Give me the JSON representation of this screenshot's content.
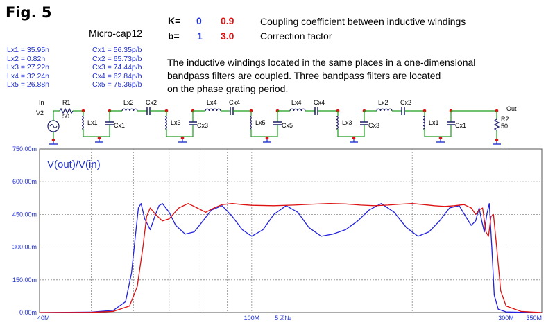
{
  "figure": {
    "label": "Fig. 5",
    "software": "Micro-cap12",
    "description_lines": [
      "The inductive windings located in the same places in a one-dimensional",
      "bandpass filters are coupled.  Three bandpass filters are located",
      "on the phase grating period."
    ]
  },
  "parameters": {
    "k_label": "K=",
    "k_values": [
      "0",
      "0.9"
    ],
    "k_desc": "Coupling coefficient between inductive windings",
    "b_label": "b=",
    "b_values": [
      "1",
      "3.0"
    ],
    "b_desc": "Correction factor",
    "colors": {
      "first": "#2233cc",
      "second": "#dd1111"
    }
  },
  "component_values": {
    "inductors": [
      "Lx1 = 35.95n",
      "Lx2 =   0.82n",
      "Lx3 = 27.22n",
      "Lx4 = 32.24n",
      "Lx5 = 26.88n"
    ],
    "capacitors": [
      "Cx1 = 56.35p/b",
      "Cx2 = 65.73p/b",
      "Cx3 = 74.44p/b",
      "Cx4 = 62.84p/b",
      "Cx5 = 75.36p/b"
    ]
  },
  "schematic": {
    "labels": {
      "in": "In",
      "v2": "V2",
      "r1": "R1",
      "r1_val": "50",
      "out": "Out",
      "r2": "R2",
      "r2_val": "50",
      "series": [
        "Lx2",
        "Cx2",
        "Lx4",
        "Cx4",
        "Lx4",
        "Cx4",
        "Lx2",
        "Cx2"
      ],
      "shunt_l": [
        "Lx1",
        "Lx3",
        "Lx5",
        "Lx3",
        "Lx1"
      ],
      "shunt_c": [
        "Cx1",
        "Cx3",
        "Cx5",
        "Cx3",
        "Cx1"
      ]
    },
    "colors": {
      "wire": "#1a9c1a",
      "component": "#1a1a66",
      "node": "#dd1111",
      "ground": "#2233cc"
    }
  },
  "chart_data": {
    "type": "line",
    "title": "",
    "annotation": "V(out)/V(in)",
    "xlabel": "",
    "ylabel": "",
    "x_scale": "log",
    "xlim": [
      40,
      350
    ],
    "ylim": [
      0,
      0.75
    ],
    "x_tick_labels": [
      "40M",
      "100M",
      "300M",
      "350M"
    ],
    "x_tick_values": [
      40,
      100,
      300,
      350
    ],
    "x_axis_mark": "5 ℤ№",
    "y_tick_labels": [
      "0.00m",
      "150.00m",
      "300.00m",
      "450.00m",
      "600.00m",
      "750.00m"
    ],
    "y_tick_values": [
      0,
      0.15,
      0.3,
      0.45,
      0.6,
      0.75
    ],
    "grid": true,
    "series": [
      {
        "color": "#2222dd",
        "x": [
          40,
          50,
          55,
          58,
          59.5,
          60.5,
          61.3,
          62,
          63,
          64.5,
          66,
          67,
          68,
          70,
          72,
          75,
          78,
          81,
          84,
          88,
          92,
          96,
          100,
          105,
          110,
          116,
          122,
          128,
          135,
          142,
          150,
          158,
          166,
          175,
          185,
          195,
          205,
          215,
          225,
          235,
          245,
          252,
          258,
          263,
          267,
          270,
          273,
          276,
          279,
          282,
          285,
          290,
          300,
          320,
          350
        ],
        "y": [
          0,
          0.002,
          0.01,
          0.05,
          0.18,
          0.35,
          0.48,
          0.5,
          0.43,
          0.38,
          0.45,
          0.49,
          0.5,
          0.46,
          0.4,
          0.36,
          0.37,
          0.42,
          0.47,
          0.49,
          0.44,
          0.38,
          0.35,
          0.38,
          0.45,
          0.49,
          0.46,
          0.39,
          0.35,
          0.36,
          0.38,
          0.42,
          0.47,
          0.5,
          0.46,
          0.39,
          0.35,
          0.37,
          0.42,
          0.48,
          0.49,
          0.44,
          0.4,
          0.42,
          0.48,
          0.42,
          0.37,
          0.45,
          0.5,
          0.3,
          0.08,
          0.015,
          0.003,
          0.001,
          0
        ]
      },
      {
        "color": "#dd1111",
        "x": [
          40,
          50,
          55,
          59,
          61,
          62.5,
          63.5,
          64.5,
          66,
          68,
          70,
          73,
          76,
          79,
          82,
          85,
          88,
          92,
          96,
          100,
          110,
          120,
          130,
          140,
          150,
          160,
          170,
          180,
          190,
          200,
          210,
          220,
          230,
          240,
          250,
          258,
          263,
          267,
          271,
          275,
          278,
          281,
          284,
          288,
          293,
          300,
          320,
          350
        ],
        "y": [
          0,
          0.001,
          0.005,
          0.03,
          0.12,
          0.3,
          0.44,
          0.48,
          0.45,
          0.42,
          0.43,
          0.48,
          0.5,
          0.48,
          0.46,
          0.48,
          0.495,
          0.5,
          0.495,
          0.492,
          0.49,
          0.493,
          0.497,
          0.5,
          0.498,
          0.493,
          0.49,
          0.493,
          0.497,
          0.5,
          0.495,
          0.49,
          0.487,
          0.49,
          0.495,
          0.48,
          0.45,
          0.47,
          0.48,
          0.37,
          0.35,
          0.44,
          0.45,
          0.3,
          0.1,
          0.03,
          0.005,
          0
        ]
      }
    ]
  }
}
